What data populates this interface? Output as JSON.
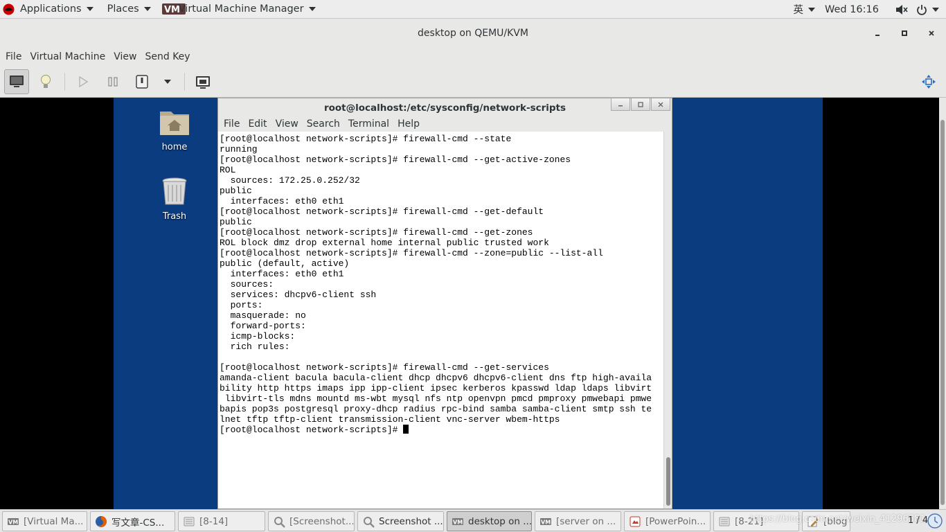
{
  "topbar": {
    "applications": "Applications",
    "places": "Places",
    "app_name": "Virtual Machine Manager",
    "input_method": "英",
    "clock": "Wed 16:16"
  },
  "window": {
    "title": "desktop on QEMU/KVM",
    "menus": [
      "File",
      "Virtual Machine",
      "View",
      "Send Key"
    ]
  },
  "toolbar": {
    "icons": [
      "monitor-icon",
      "lightbulb-icon",
      "play-icon",
      "pause-icon",
      "power-icon",
      "dropdown-icon",
      "snapshots-icon",
      "fullscreen-icon"
    ]
  },
  "guest_desktop": {
    "icons": [
      {
        "label": "home",
        "icon": "home-folder-icon"
      },
      {
        "label": "Trash",
        "icon": "trash-icon"
      }
    ]
  },
  "terminal": {
    "title": "root@localhost:/etc/sysconfig/network-scripts",
    "menus": [
      "File",
      "Edit",
      "View",
      "Search",
      "Terminal",
      "Help"
    ],
    "lines": [
      "[root@localhost network-scripts]# firewall-cmd --state",
      "running",
      "[root@localhost network-scripts]# firewall-cmd --get-active-zones",
      "ROL",
      "  sources: 172.25.0.252/32",
      "public",
      "  interfaces: eth0 eth1",
      "[root@localhost network-scripts]# firewall-cmd --get-default",
      "public",
      "[root@localhost network-scripts]# firewall-cmd --get-zones",
      "ROL block dmz drop external home internal public trusted work",
      "[root@localhost network-scripts]# firewall-cmd --zone=public --list-all",
      "public (default, active)",
      "  interfaces: eth0 eth1",
      "  sources: ",
      "  services: dhcpv6-client ssh",
      "  ports: ",
      "  masquerade: no",
      "  forward-ports: ",
      "  icmp-blocks: ",
      "  rich rules: ",
      "",
      "[root@localhost network-scripts]# firewall-cmd --get-services",
      "amanda-client bacula bacula-client dhcp dhcpv6 dhcpv6-client dns ftp high-availa",
      "bility http https imaps ipp ipp-client ipsec kerberos kpasswd ldap ldaps libvirt",
      " libvirt-tls mdns mountd ms-wbt mysql nfs ntp openvpn pmcd pmproxy pmwebapi pmwe",
      "bapis pop3s postgresql proxy-dhcp radius rpc-bind samba samba-client smtp ssh te",
      "lnet tftp tftp-client transmission-client vnc-server wbem-https",
      "[root@localhost network-scripts]# "
    ]
  },
  "taskbar": {
    "tasks": [
      {
        "label": "[Virtual Ma...",
        "icon": "virt-manager-icon",
        "state": "normal"
      },
      {
        "label": "写文章-CS...",
        "icon": "firefox-icon",
        "state": "bold"
      },
      {
        "label": "[8-14]",
        "icon": "folder-icon",
        "state": "normal"
      },
      {
        "label": "[Screenshot...",
        "icon": "screenshot-icon",
        "state": "normal"
      },
      {
        "label": "Screenshot ...",
        "icon": "screenshot-icon",
        "state": "bold"
      },
      {
        "label": "desktop on ...",
        "icon": "virt-manager-icon",
        "state": "active"
      },
      {
        "label": "[server on ...",
        "icon": "virt-manager-icon",
        "state": "normal"
      },
      {
        "label": "[PowerPoin...",
        "icon": "presentation-icon",
        "state": "normal"
      },
      {
        "label": "[8-21]",
        "icon": "folder-icon",
        "state": "normal"
      },
      {
        "label": "[blog (~/De...",
        "icon": "text-editor-icon",
        "state": "normal"
      }
    ],
    "watermark": "https://blog.csdn.net/weixin_41296581",
    "pager": "1 / 4"
  }
}
